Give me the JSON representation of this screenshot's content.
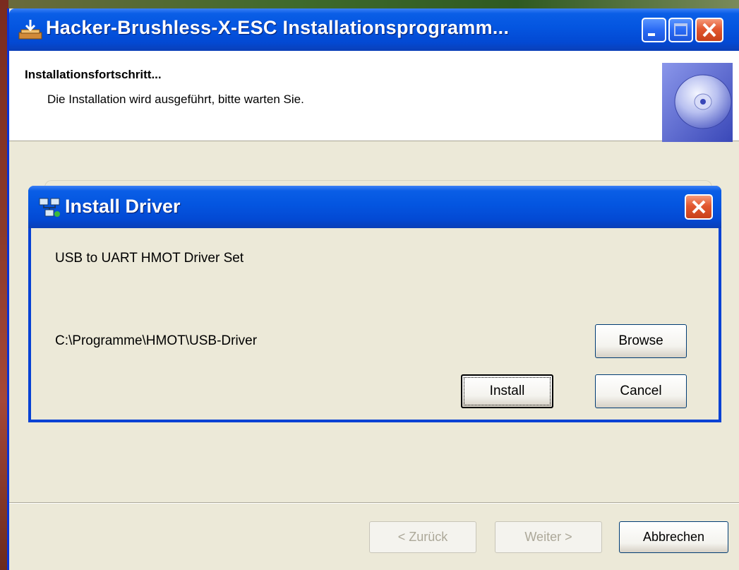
{
  "window": {
    "title": "Hacker-Brushless-X-ESC Installationsprogramm...",
    "colors": {
      "titlebar": "#0455e0",
      "body": "#ece9d8",
      "close": "#e2572f"
    }
  },
  "header": {
    "title": "Installationsfortschritt...",
    "subtitle": "Die Installation wird ausgeführt, bitte warten Sie.",
    "icon": "cd-disc-icon"
  },
  "dialog": {
    "title": "Install Driver",
    "driver_set": "USB to UART HMOT Driver Set",
    "path": "C:\\Programme\\HMOT\\USB-Driver",
    "browse_label": "Browse",
    "install_label": "Install",
    "cancel_label": "Cancel"
  },
  "footer": {
    "back_label": "< Zurück",
    "next_label": "Weiter >",
    "cancel_label": "Abbrechen"
  }
}
